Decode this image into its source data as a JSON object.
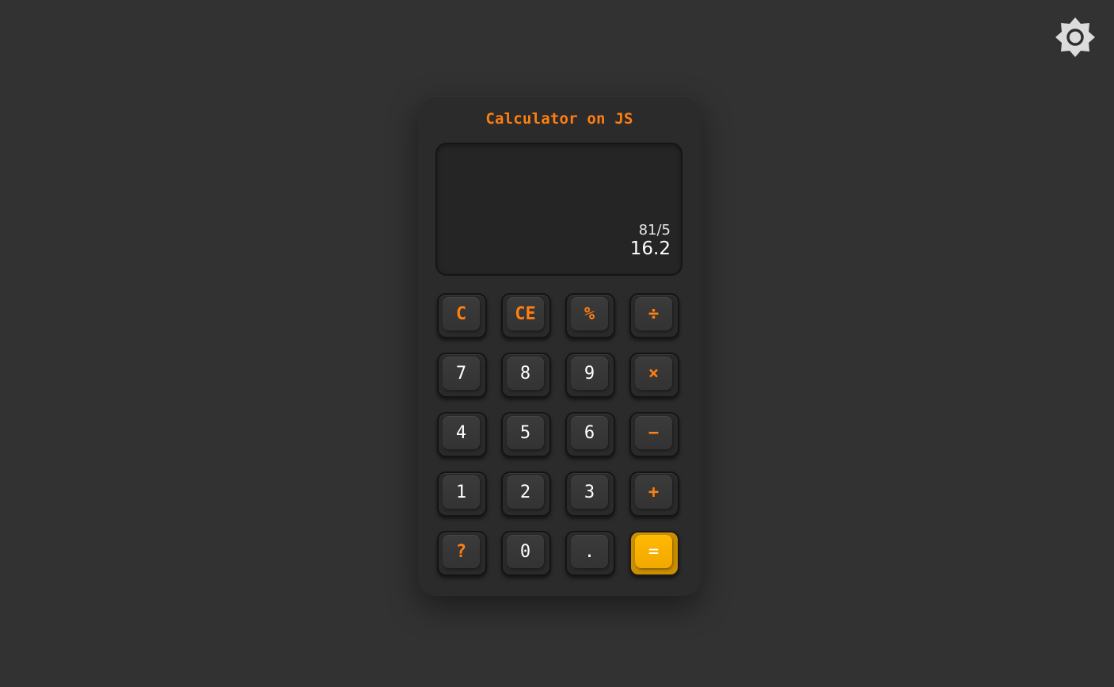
{
  "app": {
    "title": "Calculator on JS"
  },
  "theme_toggle": {
    "icon": "sun-icon"
  },
  "display": {
    "expression": "81/5",
    "result": "16.2"
  },
  "keys": [
    {
      "label": "C",
      "kind": "op"
    },
    {
      "label": "CE",
      "kind": "op"
    },
    {
      "label": "%",
      "kind": "op"
    },
    {
      "label": "÷",
      "kind": "op"
    },
    {
      "label": "7",
      "kind": "num"
    },
    {
      "label": "8",
      "kind": "num"
    },
    {
      "label": "9",
      "kind": "num"
    },
    {
      "label": "×",
      "kind": "op"
    },
    {
      "label": "4",
      "kind": "num"
    },
    {
      "label": "5",
      "kind": "num"
    },
    {
      "label": "6",
      "kind": "num"
    },
    {
      "label": "−",
      "kind": "op"
    },
    {
      "label": "1",
      "kind": "num"
    },
    {
      "label": "2",
      "kind": "num"
    },
    {
      "label": "3",
      "kind": "num"
    },
    {
      "label": "+",
      "kind": "op"
    },
    {
      "label": "?",
      "kind": "op"
    },
    {
      "label": "0",
      "kind": "num"
    },
    {
      "label": ".",
      "kind": "num"
    },
    {
      "label": "=",
      "kind": "eq"
    }
  ],
  "colors": {
    "background": "#323232",
    "accent": "#ff7f11",
    "equals": "#ffb900"
  }
}
